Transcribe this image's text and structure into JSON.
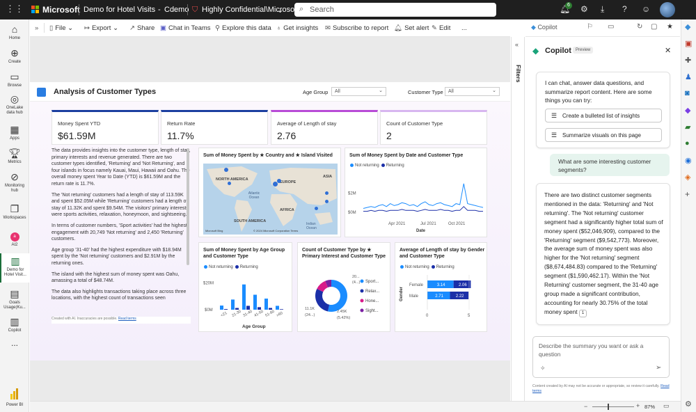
{
  "topbar": {
    "brand": "Microsoft",
    "report_name": "Demo for Hotel Visits",
    "separator": "-",
    "workspace": "Cdemo",
    "sensitivity": "Highly Confidential\\Microsoft FTE",
    "search_placeholder": "Search",
    "notification_count": "6"
  },
  "rail": {
    "items": [
      {
        "label": "Home",
        "icon": "home-icon"
      },
      {
        "label": "Create",
        "icon": "create-icon"
      },
      {
        "label": "Browse",
        "icon": "browse-icon"
      },
      {
        "label": "OneLake data hub",
        "icon": "onelake-icon"
      },
      {
        "label": "Apps",
        "icon": "apps-icon"
      },
      {
        "label": "Metrics",
        "icon": "metrics-icon"
      },
      {
        "label": "Monitoring hub",
        "icon": "monitoring-icon"
      },
      {
        "label": "Workspaces",
        "icon": "workspaces-icon"
      },
      {
        "label": "AI2",
        "icon": "ai2-icon"
      },
      {
        "label": "Demo for Hotel Visit...",
        "icon": "report-icon"
      },
      {
        "label": "Goals Usage(Ku...",
        "icon": "goals-icon"
      },
      {
        "label": "Copilot",
        "icon": "copilot-icon"
      },
      {
        "label": "...",
        "icon": "more-icon"
      }
    ],
    "powerbi_label": "Power BI"
  },
  "toolbar": {
    "file": "File",
    "export": "Export",
    "share": "Share",
    "chat_in_teams": "Chat in Teams",
    "explore": "Explore this data",
    "insights": "Get insights",
    "subscribe": "Subscribe to report",
    "alert": "Set alert",
    "edit": "Edit",
    "more": "..."
  },
  "report": {
    "title": "Analysis of Customer Types",
    "age_group_label": "Age Group",
    "age_group_value": "All",
    "customer_type_label": "Customer Type",
    "customer_type_value": "All",
    "kpis": [
      {
        "label": "Money Spent YTD",
        "value": "$61.59M",
        "accent": "#1b3fa0"
      },
      {
        "label": "Return Rate",
        "value": "11.7%",
        "accent": "#1b3fa0"
      },
      {
        "label": "Average of Length of stay",
        "value": "2.76",
        "accent": "#b84bd6"
      },
      {
        "label": "Count of Customer Type",
        "value": "2",
        "accent": "#d7b6f0"
      }
    ],
    "narrative": [
      "The data provides insights into the customer type, length of stay, primary interests and revenue generated. There are two customer types identified, 'Returning' and 'Not Returning', and four islands in focus namely Kauai, Maui, Hawaii and Oahu. The overall money spent Year to Date (YTD) is $61.59M and the return rate is 11.7%.",
      "The 'Not returning' customers had a length of stay of 113.59K and spent $52.05M while 'Returning' customers had a length of stay of 11.32K and spent $9.54M. The visitors' primary interests were sports activities, relaxation, honeymoon, and sightseeing.",
      "In terms of customer numbers, 'Sport activities' had the highest engagement with 20,749 'Not returning' and 2,450 'Returning' customers.",
      "Age group '31-40' had the highest expenditure with $18.94M spent by the 'Not returning' customers and $2.91M by the returning ones.",
      "The island with the highest sum of money spent was Oahu, amassing a total of $48.74M.",
      "The data also highlights transactions taking place across three locations, with the highest count of transactions seen"
    ],
    "narrative_footer": "Created with AI. Inaccuracies are possible.",
    "narrative_footer_link": "Read terms",
    "map": {
      "title": "Sum of Money Spent by ★ Country and ★ Island Visited",
      "labels": [
        "NORTH AMERICA",
        "EUROPE",
        "ASIA",
        "Atlantic Ocean",
        "AFRICA",
        "SOUTH AMERICA",
        "Indian Ocean"
      ],
      "copyright": "© 2024 Microsoft Corporation Terms",
      "bing": "Microsoft Bing"
    },
    "date_chart_title": "Sum of Money Spent by Date and Customer Type",
    "age_chart_title": "Sum of Money Spent by Age Group and Customer Type",
    "donut_title": "Count of Customer Type by ★ Primary Interest and Customer Type",
    "gender_chart_title": "Average of Length of stay by Gender and Customer Type",
    "legend_not_returning": "Not returning",
    "legend_returning": "Returning",
    "colors": {
      "not_returning": "#1a8cff",
      "returning": "#1b2fa8"
    }
  },
  "chart_data": [
    {
      "type": "line",
      "title": "Sum of Money Spent by Date and Customer Type",
      "xlabel": "Date",
      "x_ticks": [
        "Apr 2021",
        "Jul 2021",
        "Oct 2021"
      ],
      "y_ticks": [
        "$0M",
        "$2M"
      ],
      "series": [
        {
          "name": "Not returning",
          "values": [
            0.4,
            0.5,
            0.6,
            0.5,
            0.7,
            0.8,
            0.6,
            0.9,
            0.7,
            0.8,
            1.0,
            0.9,
            0.7,
            0.8,
            0.6,
            0.9,
            1.1,
            0.8,
            0.7,
            0.9,
            1.0,
            0.8,
            0.7,
            0.6,
            0.9,
            0.8,
            3.0,
            0.9,
            0.8,
            0.7,
            0.6,
            0.5
          ]
        },
        {
          "name": "Returning",
          "values": [
            0.1,
            0.1,
            0.2,
            0.1,
            0.2,
            0.2,
            0.1,
            0.2,
            0.2,
            0.2,
            0.3,
            0.2,
            0.2,
            0.2,
            0.1,
            0.2,
            0.3,
            0.2,
            0.2,
            0.2,
            0.3,
            0.2,
            0.2,
            0.1,
            0.2,
            0.2,
            0.6,
            0.2,
            0.2,
            0.2,
            0.1,
            0.1
          ]
        }
      ]
    },
    {
      "type": "bar",
      "title": "Sum of Money Spent by Age Group and Customer Type",
      "xlabel": "Age Group",
      "categories": [
        "<21",
        "21-30",
        "31-40",
        "41-50",
        "51-60",
        ">60"
      ],
      "y_ticks": [
        "$0M",
        "$20M"
      ],
      "series": [
        {
          "name": "Not returning",
          "values": [
            3.1,
            7.6,
            18.9,
            11.2,
            8.3,
            2.9
          ]
        },
        {
          "name": "Returning",
          "values": [
            0.5,
            1.3,
            2.9,
            1.9,
            1.3,
            0.4
          ]
        }
      ]
    },
    {
      "type": "pie",
      "title": "Count of Customer Type by ★ Primary Interest and Customer Type",
      "labels": [
        "Sport...",
        "Relax...",
        "Hone...",
        "Sight..."
      ],
      "values": [
        20.7,
        11.1,
        4.5,
        2.4
      ],
      "data_labels": [
        "20...",
        "(4...)",
        "11.1K",
        "(24...)",
        "2.45K",
        "(5.42%)"
      ],
      "colors": [
        "#1a8cff",
        "#1b2fa8",
        "#d81b8a",
        "#7b1fa2"
      ]
    },
    {
      "type": "bar",
      "title": "Average of Length of stay by Gender and Customer Type",
      "orientation": "horizontal",
      "ylabel": "Gender",
      "categories": [
        "Female",
        "Male"
      ],
      "x_ticks": [
        "0",
        "5"
      ],
      "xlim": [
        0,
        5
      ],
      "series": [
        {
          "name": "Not returning",
          "values": [
            3.14,
            2.71
          ]
        },
        {
          "name": "Returning",
          "values": [
            2.06,
            2.22
          ]
        }
      ]
    }
  ],
  "copilot": {
    "tab_label": "Copilot",
    "title": "Copilot",
    "badge": "Preview",
    "intro": "I can chat, answer data questions, and summarize report content. Here are some things you can try:",
    "suggestions": [
      "Create a bulleted list of insights",
      "Summarize visuals on this page"
    ],
    "user_message": "What are some interesting customer segments?",
    "answer": "There are two distinct customer segments mentioned in the data: 'Returning' and 'Not returning'. The 'Not returning' customer segment had a significantly higher total sum of money spent ($52,046,909), compared to the 'Returning' segment ($9,542,773). Moreover, the average sum of money spent was also higher for the 'Not returning' segment ($8,674,484.83) compared to the 'Returning' segment ($1,590,462.17). Within the 'Not Returning' customer segment, the 31-40 age group made a significant contribution, accounting for nearly 30.75% of the total money spent",
    "citation": "1",
    "input_placeholder": "Describe the summary you want or ask a question",
    "disclaimer": "Content created by AI may not be accurate or appropriate, so review it carefully.",
    "disclaimer_link": "Read terms",
    "filters_label": "Filters"
  },
  "status": {
    "zoom": "87%"
  }
}
